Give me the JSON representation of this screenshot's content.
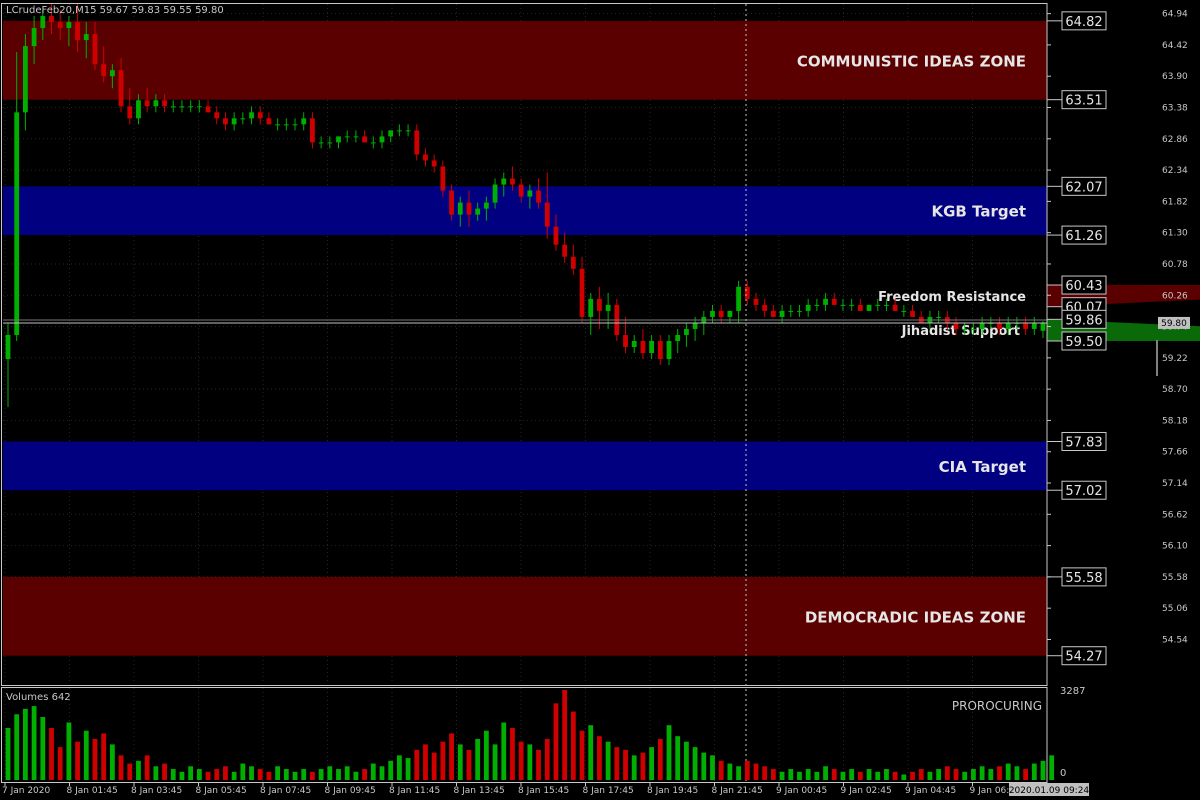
{
  "header": {
    "symbol_info": "LCrudeFeb20,M15  59.67 59.83 59.55 59.80"
  },
  "colors": {
    "background": "#000000",
    "red_zone": "#5a0000",
    "blue_zone": "#000080",
    "bull": "#00b000",
    "bear": "#d00000",
    "grid": "#262626",
    "axis_text": "#c8c8c8",
    "line_box_border": "#c8c8c8"
  },
  "chart_data": {
    "type": "candlestick",
    "price_axis": {
      "ylim": [
        53.8,
        65.1
      ],
      "ticks": [
        "64.94",
        "64.42",
        "63.90",
        "63.38",
        "62.86",
        "62.34",
        "61.82",
        "61.30",
        "60.78",
        "60.26",
        "59.74",
        "59.22",
        "58.70",
        "58.18",
        "57.66",
        "57.14",
        "56.62",
        "56.10",
        "55.58",
        "55.06",
        "54.54"
      ]
    },
    "time_axis": {
      "labels": [
        "7 Jan 2020",
        "8 Jan 01:45",
        "8 Jan 03:45",
        "8 Jan 05:45",
        "8 Jan 07:45",
        "8 Jan 09:45",
        "8 Jan 11:45",
        "8 Jan 13:45",
        "8 Jan 15:45",
        "8 Jan 17:45",
        "8 Jan 19:45",
        "8 Jan 21:45",
        "9 Jan 00:45",
        "9 Jan 02:45",
        "9 Jan 04:45",
        "9 Jan 06:45"
      ],
      "cursor_label": "2020.01.09 09:24"
    },
    "zones": [
      {
        "label": "COMMUNISTIC IDEAS ZONE",
        "top": 64.82,
        "bottom": 63.51,
        "color": "red"
      },
      {
        "label": "KGB Target",
        "top": 62.07,
        "bottom": 61.26,
        "color": "blue"
      },
      {
        "label": "CIA Target",
        "top": 57.83,
        "bottom": 57.02,
        "color": "blue"
      },
      {
        "label": "DEMOCRADIC IDEAS ZONE",
        "top": 55.58,
        "bottom": 54.27,
        "color": "red"
      }
    ],
    "trend_zones": {
      "resistance": {
        "label": "Freedom Resistance",
        "start": {
          "x": 175,
          "y": 60.44
        },
        "end_top": 60.43,
        "end_bottom": 60.07
      },
      "support": {
        "label": "Jihadist Support",
        "start": {
          "x": 175,
          "y": 59.5
        },
        "end_top": 59.86,
        "end_bottom": 59.5
      }
    },
    "price_levels": [
      "64.82",
      "63.51",
      "62.07",
      "61.26",
      "60.43",
      "60.07",
      "59.86",
      "59.50",
      "57.83",
      "57.02",
      "55.58",
      "54.27"
    ],
    "current_price": "59.80",
    "candles": [
      [
        59.2,
        59.8,
        58.4,
        59.6
      ],
      [
        59.6,
        64.3,
        59.5,
        63.3
      ],
      [
        63.3,
        64.6,
        63.0,
        64.4
      ],
      [
        64.4,
        64.9,
        64.1,
        64.7
      ],
      [
        64.7,
        65.0,
        64.5,
        64.9
      ],
      [
        64.9,
        65.1,
        64.6,
        64.8
      ],
      [
        64.8,
        65.0,
        64.5,
        64.7
      ],
      [
        64.7,
        64.9,
        64.4,
        64.8
      ],
      [
        64.8,
        65.1,
        64.3,
        64.5
      ],
      [
        64.5,
        64.8,
        64.2,
        64.6
      ],
      [
        64.6,
        64.8,
        64.0,
        64.1
      ],
      [
        64.1,
        64.4,
        63.8,
        63.9
      ],
      [
        63.9,
        64.1,
        63.7,
        64.0
      ],
      [
        64.0,
        64.2,
        63.3,
        63.4
      ],
      [
        63.4,
        63.7,
        63.1,
        63.2
      ],
      [
        63.2,
        63.6,
        63.1,
        63.5
      ],
      [
        63.5,
        63.7,
        63.3,
        63.4
      ],
      [
        63.4,
        63.6,
        63.3,
        63.5
      ],
      [
        63.5,
        63.6,
        63.3,
        63.4
      ],
      [
        63.4,
        63.5,
        63.3,
        63.4
      ],
      [
        63.4,
        63.5,
        63.3,
        63.4
      ],
      [
        63.4,
        63.5,
        63.3,
        63.4
      ],
      [
        63.4,
        63.5,
        63.3,
        63.4
      ],
      [
        63.4,
        63.5,
        63.3,
        63.3
      ],
      [
        63.3,
        63.4,
        63.1,
        63.2
      ],
      [
        63.2,
        63.3,
        63.0,
        63.1
      ],
      [
        63.1,
        63.3,
        63.0,
        63.2
      ],
      [
        63.2,
        63.3,
        63.1,
        63.2
      ],
      [
        63.2,
        63.4,
        63.1,
        63.3
      ],
      [
        63.3,
        63.4,
        63.1,
        63.2
      ],
      [
        63.2,
        63.3,
        63.1,
        63.1
      ],
      [
        63.1,
        63.2,
        63.0,
        63.1
      ],
      [
        63.1,
        63.2,
        63.0,
        63.1
      ],
      [
        63.1,
        63.2,
        63.0,
        63.1
      ],
      [
        63.1,
        63.3,
        63.0,
        63.2
      ],
      [
        63.2,
        63.3,
        62.7,
        62.8
      ],
      [
        62.8,
        62.9,
        62.7,
        62.8
      ],
      [
        62.8,
        62.9,
        62.7,
        62.8
      ],
      [
        62.8,
        62.9,
        62.7,
        62.9
      ],
      [
        62.9,
        63.0,
        62.8,
        62.9
      ],
      [
        62.9,
        63.0,
        62.8,
        62.9
      ],
      [
        62.9,
        63.0,
        62.8,
        62.8
      ],
      [
        62.8,
        62.9,
        62.7,
        62.8
      ],
      [
        62.8,
        63.0,
        62.7,
        62.9
      ],
      [
        62.9,
        63.0,
        62.8,
        63.0
      ],
      [
        63.0,
        63.1,
        62.9,
        63.0
      ],
      [
        63.0,
        63.1,
        62.9,
        63.0
      ],
      [
        63.0,
        63.1,
        62.5,
        62.6
      ],
      [
        62.6,
        62.7,
        62.4,
        62.5
      ],
      [
        62.5,
        62.6,
        62.3,
        62.4
      ],
      [
        62.4,
        62.5,
        61.9,
        62.0
      ],
      [
        62.0,
        62.1,
        61.5,
        61.6
      ],
      [
        61.6,
        61.9,
        61.4,
        61.8
      ],
      [
        61.8,
        62.0,
        61.4,
        61.6
      ],
      [
        61.6,
        61.8,
        61.5,
        61.7
      ],
      [
        61.7,
        61.9,
        61.5,
        61.8
      ],
      [
        61.8,
        62.2,
        61.7,
        62.1
      ],
      [
        62.1,
        62.3,
        61.9,
        62.2
      ],
      [
        62.2,
        62.4,
        62.0,
        62.1
      ],
      [
        62.1,
        62.2,
        61.8,
        61.9
      ],
      [
        61.9,
        62.1,
        61.7,
        62.0
      ],
      [
        62.0,
        62.2,
        61.7,
        61.8
      ],
      [
        61.8,
        62.3,
        61.2,
        61.4
      ],
      [
        61.4,
        61.6,
        61.0,
        61.1
      ],
      [
        61.1,
        61.3,
        60.8,
        60.9
      ],
      [
        60.9,
        61.1,
        60.6,
        60.7
      ],
      [
        60.7,
        60.9,
        59.8,
        59.9
      ],
      [
        59.9,
        60.3,
        59.6,
        60.2
      ],
      [
        60.2,
        60.4,
        59.7,
        60.0
      ],
      [
        60.0,
        60.3,
        59.7,
        60.1
      ],
      [
        60.1,
        60.2,
        59.5,
        59.6
      ],
      [
        59.6,
        59.9,
        59.3,
        59.4
      ],
      [
        59.4,
        59.6,
        59.3,
        59.5
      ],
      [
        59.5,
        59.7,
        59.2,
        59.3
      ],
      [
        59.3,
        59.6,
        59.2,
        59.5
      ],
      [
        59.5,
        59.6,
        59.1,
        59.2
      ],
      [
        59.2,
        59.6,
        59.1,
        59.5
      ],
      [
        59.5,
        59.7,
        59.3,
        59.6
      ],
      [
        59.6,
        59.8,
        59.4,
        59.7
      ],
      [
        59.7,
        59.9,
        59.5,
        59.8
      ],
      [
        59.8,
        60.0,
        59.6,
        59.9
      ],
      [
        59.9,
        60.1,
        59.8,
        60.0
      ],
      [
        60.0,
        60.1,
        59.8,
        59.9
      ],
      [
        59.9,
        60.0,
        59.8,
        60.0
      ],
      [
        60.0,
        60.5,
        59.8,
        60.4
      ],
      [
        60.4,
        60.5,
        60.1,
        60.2
      ],
      [
        60.2,
        60.3,
        60.0,
        60.1
      ],
      [
        60.1,
        60.2,
        59.9,
        60.0
      ],
      [
        60.0,
        60.1,
        59.9,
        59.9
      ],
      [
        59.9,
        60.1,
        59.8,
        60.0
      ],
      [
        60.0,
        60.1,
        59.9,
        60.0
      ],
      [
        60.0,
        60.1,
        59.9,
        60.0
      ],
      [
        60.0,
        60.2,
        59.9,
        60.1
      ],
      [
        60.1,
        60.2,
        60.0,
        60.1
      ],
      [
        60.1,
        60.3,
        60.0,
        60.2
      ],
      [
        60.2,
        60.3,
        60.1,
        60.1
      ],
      [
        60.1,
        60.2,
        60.0,
        60.1
      ],
      [
        60.1,
        60.2,
        60.0,
        60.1
      ],
      [
        60.1,
        60.2,
        60.0,
        60.0
      ],
      [
        60.0,
        60.1,
        60.0,
        60.1
      ],
      [
        60.1,
        60.2,
        60.0,
        60.1
      ],
      [
        60.1,
        60.2,
        60.0,
        60.1
      ],
      [
        60.1,
        60.2,
        60.0,
        60.0
      ],
      [
        60.0,
        60.1,
        59.9,
        60.0
      ],
      [
        60.0,
        60.1,
        59.9,
        59.9
      ],
      [
        59.9,
        60.0,
        59.8,
        59.8
      ],
      [
        59.8,
        60.0,
        59.7,
        59.9
      ],
      [
        59.9,
        60.0,
        59.8,
        59.9
      ],
      [
        59.9,
        60.0,
        59.7,
        59.8
      ],
      [
        59.8,
        59.9,
        59.6,
        59.7
      ],
      [
        59.7,
        59.8,
        59.6,
        59.7
      ],
      [
        59.7,
        59.8,
        59.6,
        59.7
      ],
      [
        59.7,
        59.9,
        59.6,
        59.8
      ],
      [
        59.8,
        59.9,
        59.7,
        59.8
      ],
      [
        59.8,
        59.9,
        59.6,
        59.7
      ],
      [
        59.7,
        59.9,
        59.6,
        59.8
      ],
      [
        59.8,
        59.9,
        59.7,
        59.8
      ],
      [
        59.8,
        59.9,
        59.6,
        59.7
      ],
      [
        59.7,
        59.9,
        59.6,
        59.8
      ],
      [
        59.67,
        59.83,
        59.55,
        59.8
      ]
    ],
    "volume_panel": {
      "label": "Volumes 642",
      "scale_max": "3287",
      "scale_min": "0",
      "right_label": "PROROCURING",
      "ylim": [
        0,
        3287
      ],
      "values": [
        1900,
        2400,
        2600,
        2700,
        2300,
        1900,
        1200,
        2100,
        1400,
        1800,
        1500,
        1700,
        1300,
        900,
        600,
        700,
        900,
        500,
        600,
        400,
        300,
        500,
        400,
        300,
        400,
        500,
        300,
        600,
        500,
        400,
        300,
        500,
        400,
        300,
        400,
        300,
        400,
        500,
        400,
        500,
        300,
        400,
        600,
        500,
        700,
        900,
        800,
        1100,
        1300,
        1000,
        1400,
        1700,
        1300,
        1100,
        1500,
        1800,
        1300,
        2100,
        1900,
        1400,
        1300,
        1100,
        1500,
        2800,
        3287,
        2500,
        1800,
        2000,
        1600,
        1400,
        1200,
        1100,
        900,
        1000,
        1200,
        1500,
        2000,
        1600,
        1400,
        1200,
        1000,
        900,
        700,
        600,
        500,
        700,
        600,
        500,
        400,
        300,
        400,
        300,
        400,
        300,
        500,
        400,
        300,
        400,
        300,
        400,
        300,
        400,
        300,
        200,
        300,
        400,
        300,
        400,
        500,
        400,
        300,
        400,
        500,
        400,
        500,
        600,
        500,
        400,
        600,
        700,
        900
      ]
    }
  }
}
